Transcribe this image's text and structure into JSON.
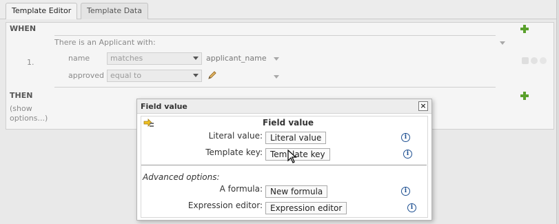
{
  "tabs": [
    {
      "label": "Template Editor",
      "active": true
    },
    {
      "label": "Template Data",
      "active": false
    }
  ],
  "rule": {
    "when_label": "WHEN",
    "pattern_text": "There is an Applicant with:",
    "row_number": "1.",
    "constraints": [
      {
        "field": "name",
        "operator": "matches",
        "value": "applicant_name"
      },
      {
        "field": "approved",
        "operator": "equal to",
        "value": ""
      }
    ],
    "then_label": "THEN",
    "show_options_line1": "(show",
    "show_options_line2": "options...)"
  },
  "popup": {
    "header": "Field value",
    "close_label": "×",
    "title": "Field value",
    "literal_label": "Literal value:",
    "literal_button": "Literal value",
    "template_key_label": "Template key:",
    "template_key_button": "Template key",
    "advanced_label": "Advanced options:",
    "formula_label": "A formula:",
    "formula_button": "New formula",
    "expression_label": "Expression editor:",
    "expression_button": "Expression editor",
    "info_glyph": "i"
  },
  "colors": {
    "accent_plus": "#5aa02c",
    "info_blue": "#1d4f91"
  }
}
